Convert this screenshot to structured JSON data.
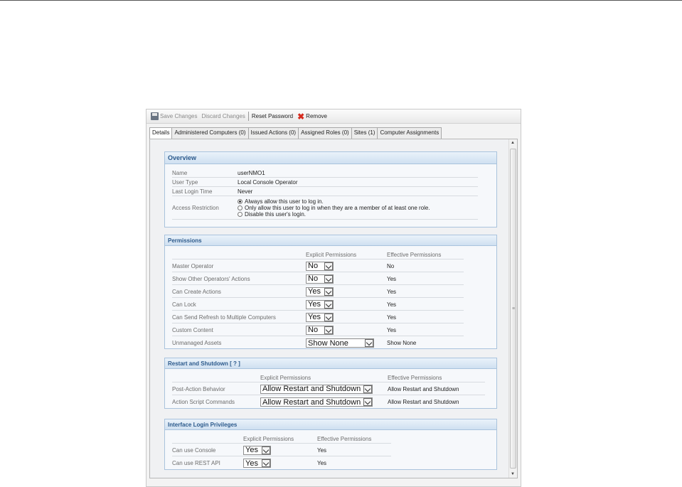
{
  "toolbar": {
    "save": "Save Changes",
    "discard": "Discard Changes",
    "reset": "Reset Password",
    "remove": "Remove"
  },
  "tabs": [
    "Details",
    "Administered Computers (0)",
    "Issued Actions (0)",
    "Assigned Roles (0)",
    "Sites (1)",
    "Computer Assignments"
  ],
  "overview": {
    "title": "Overview",
    "name_label": "Name",
    "name_value": "userNMO1",
    "type_label": "User Type",
    "type_value": "Local Console Operator",
    "login_label": "Last Login Time",
    "login_value": "Never",
    "access_label": "Access Restriction",
    "access_options": [
      "Always allow this user to log in.",
      "Only allow this user to log in when they are a member of at least one role.",
      "Disable this user's login."
    ],
    "access_selected": 0
  },
  "permissions": {
    "title": "Permissions",
    "col_explicit": "Explicit Permissions",
    "col_effective": "Effective Permissions",
    "rows": [
      {
        "label": "Master Operator",
        "explicit": "No",
        "effective": "No"
      },
      {
        "label": "Show Other Operators' Actions",
        "explicit": "No",
        "effective": "Yes"
      },
      {
        "label": "Can Create Actions",
        "explicit": "Yes",
        "effective": "Yes"
      },
      {
        "label": "Can Lock",
        "explicit": "Yes",
        "effective": "Yes"
      },
      {
        "label": "Can Send Refresh to Multiple Computers",
        "explicit": "Yes",
        "effective": "Yes"
      },
      {
        "label": "Custom Content",
        "explicit": "No",
        "effective": "Yes"
      },
      {
        "label": "Unmanaged Assets",
        "explicit": "Show None",
        "effective": "Show None"
      }
    ]
  },
  "restart": {
    "title": "Restart and Shutdown",
    "help": "[ ? ]",
    "col_explicit": "Explicit Permissions",
    "col_effective": "Effective Permissions",
    "rows": [
      {
        "label": "Post-Action Behavior",
        "explicit": "Allow Restart and Shutdown",
        "effective": "Allow Restart and Shutdown"
      },
      {
        "label": "Action Script Commands",
        "explicit": "Allow Restart and Shutdown",
        "effective": "Allow Restart and Shutdown"
      }
    ]
  },
  "interface": {
    "title": "Interface Login Privileges",
    "col_explicit": "Explicit Permissions",
    "col_effective": "Effective Permissions",
    "rows": [
      {
        "label": "Can use Console",
        "explicit": "Yes",
        "effective": "Yes"
      },
      {
        "label": "Can use REST API",
        "explicit": "Yes",
        "effective": "Yes"
      }
    ]
  }
}
